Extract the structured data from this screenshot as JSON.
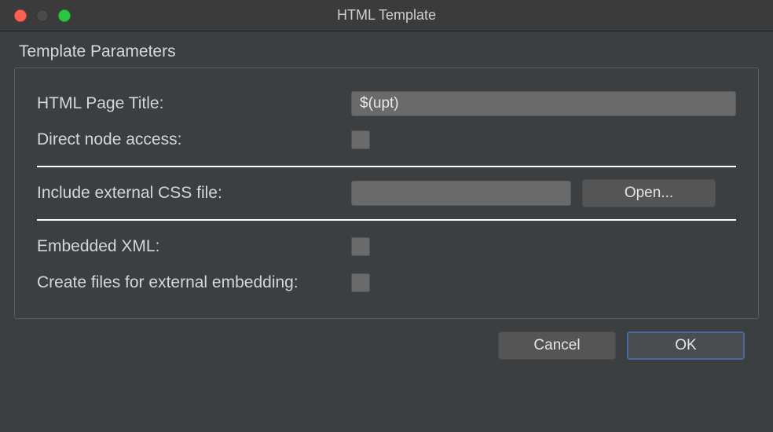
{
  "window": {
    "title": "HTML Template"
  },
  "section": {
    "label": "Template Parameters"
  },
  "fields": {
    "pageTitle": {
      "label": "HTML Page Title:",
      "value": "$(upt)"
    },
    "directNode": {
      "label": "Direct node access:"
    },
    "externalCss": {
      "label": "Include external CSS file:",
      "value": "",
      "openLabel": "Open..."
    },
    "embeddedXml": {
      "label": "Embedded XML:"
    },
    "createFiles": {
      "label": "Create files for external embedding:"
    }
  },
  "buttons": {
    "cancel": "Cancel",
    "ok": "OK"
  }
}
